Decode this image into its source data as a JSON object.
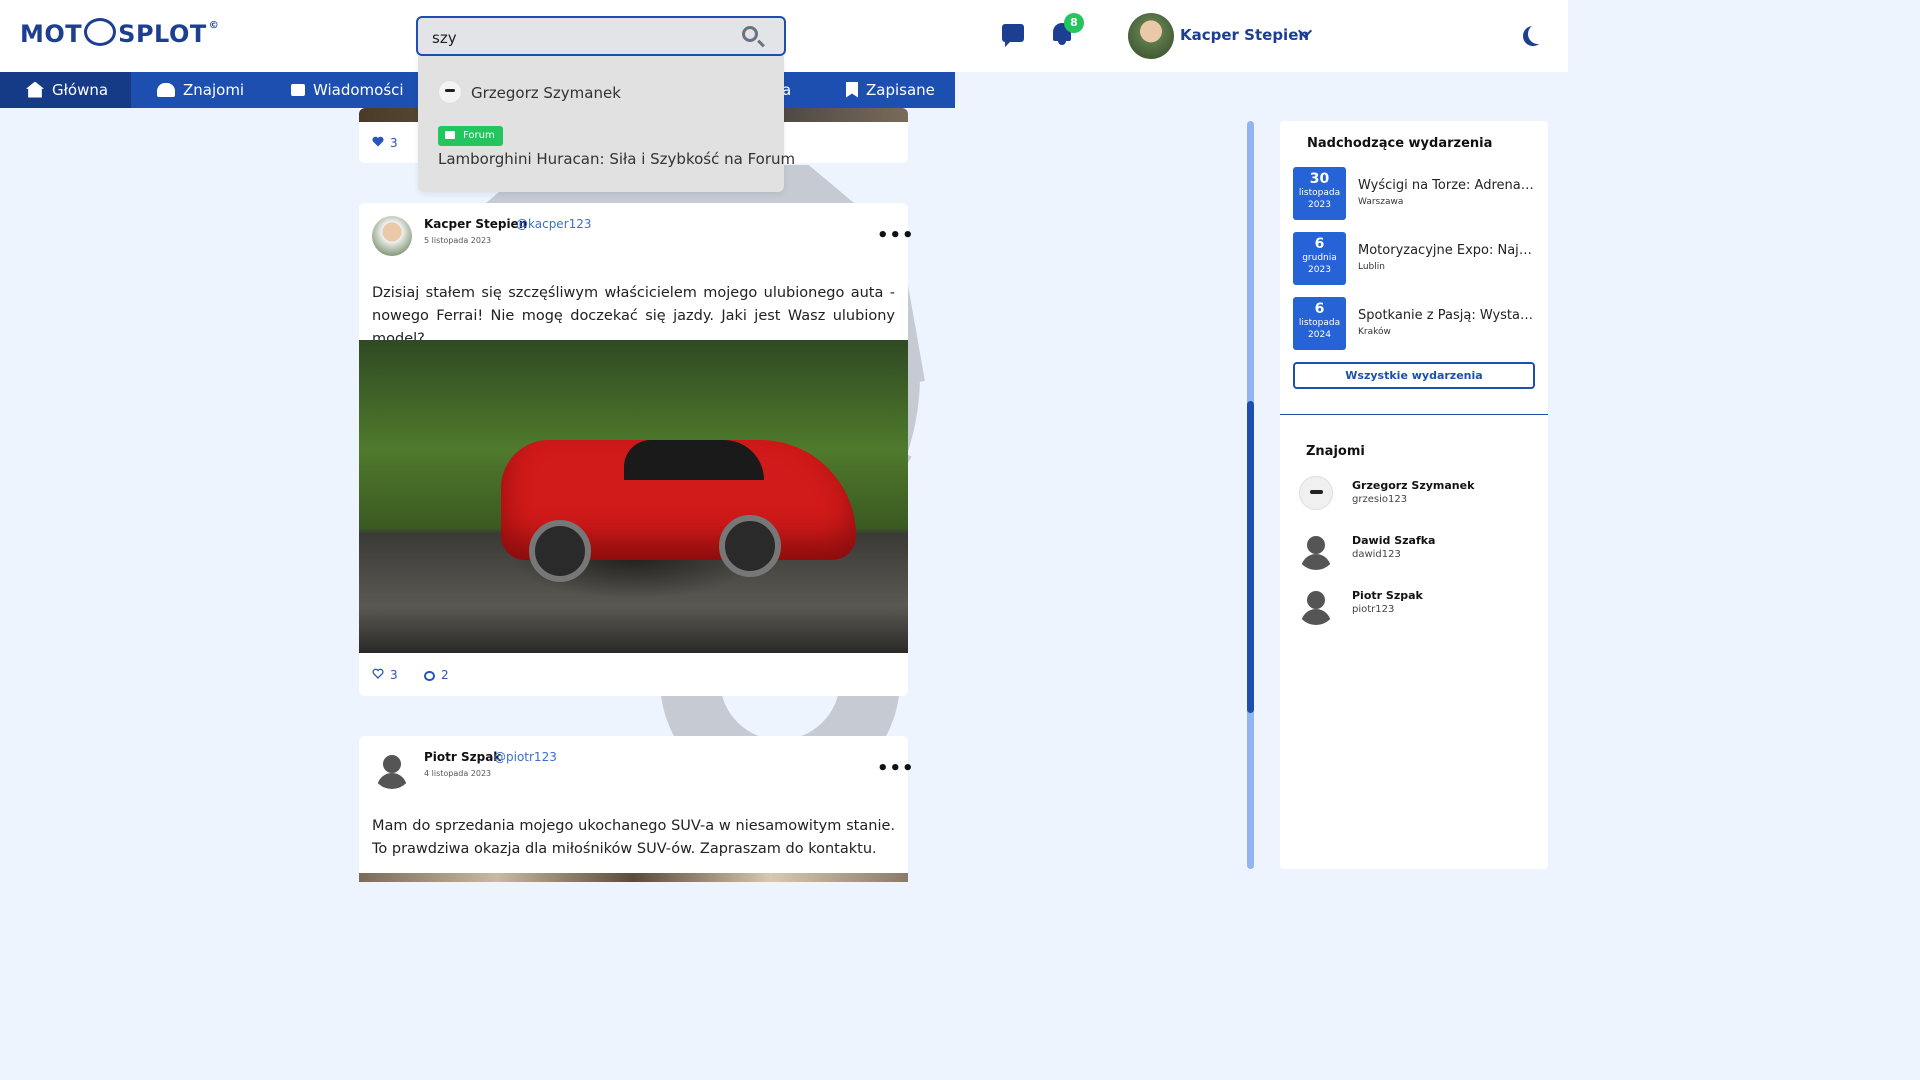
{
  "brand": {
    "logo_left": "MOT",
    "logo_right": "SPLOT",
    "logo_mark": "©"
  },
  "search": {
    "value": "szy",
    "placeholder": ""
  },
  "header": {
    "notifications_count": "8",
    "user_name": "Kacper Stepien"
  },
  "nav": {
    "items": [
      {
        "label": "Główna",
        "icon": "home-icon"
      },
      {
        "label": "Znajomi",
        "icon": "users-icon"
      },
      {
        "label": "Wiadomości",
        "icon": "message-icon"
      },
      {
        "label": "a",
        "icon": ""
      },
      {
        "label": "Zapisane",
        "icon": "bookmark-icon"
      }
    ]
  },
  "dropdown": {
    "user_result": "Grzegorz Szymanek",
    "forum_badge": "Forum",
    "forum_result": "Lamborghini Huracan: Siła i Szybkość na Forum"
  },
  "posts": [
    {
      "likes": "3"
    },
    {
      "author": "Kacper Stepien",
      "handle": "@kacper123",
      "date": "5 listopada 2023",
      "text": "Dzisiaj stałem się szczęśliwym właścicielem mojego ulubionego auta - nowego Ferrai! Nie mogę doczekać się jazdy. Jaki jest Wasz ulubiony model?",
      "likes": "3",
      "comments": "2",
      "menu": "•••"
    },
    {
      "author": "Piotr Szpak",
      "handle": "@piotr123",
      "date": "4 listopada 2023",
      "text": "Mam do sprzedania mojego ukochanego SUV-a w niesamowitym stanie. To prawdziwa okazja dla miłośników SUV-ów. Zapraszam do kontaktu.",
      "menu": "•••"
    }
  ],
  "events": {
    "title": "Nadchodzące wydarzenia",
    "items": [
      {
        "day": "30",
        "month": "listopada",
        "year": "2023",
        "title": "Wyścigi na Torze: Adrenalina",
        "place": "Warszawa"
      },
      {
        "day": "6",
        "month": "grudnia",
        "year": "2023",
        "title": "Motoryzacyjne Expo: Najnowsze",
        "place": "Lublin"
      },
      {
        "day": "6",
        "month": "listopada",
        "year": "2024",
        "title": "Spotkanie z Pasją: Wystawa",
        "place": "Kraków"
      }
    ],
    "all_button": "Wszystkie wydarzenia"
  },
  "friends": {
    "title": "Znajomi",
    "items": [
      {
        "name": "Grzegorz Szymanek",
        "handle": "grzesio123"
      },
      {
        "name": "Dawid Szafka",
        "handle": "dawid123"
      },
      {
        "name": "Piotr Szpak",
        "handle": "piotr123"
      }
    ]
  },
  "colors": {
    "primary": "#1d4fb1",
    "dark_blue": "#1d3f91",
    "green": "#22c55e",
    "background": "#eef4fd"
  }
}
